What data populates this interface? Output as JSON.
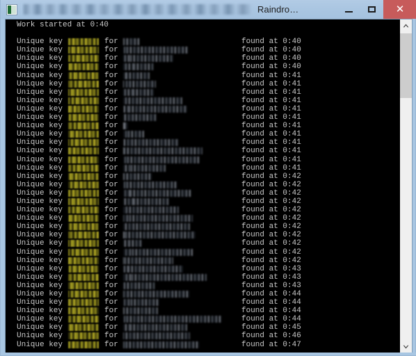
{
  "window": {
    "title_visible": "Raindro…",
    "title_redacted": true,
    "app_icon": "console-icon",
    "caption": {
      "minimize_label": "—",
      "maximize_label": "▢",
      "close_label": "✕",
      "close_color": "#c75b5b"
    },
    "titlebar_color": "#a9c5e1",
    "frame_color": "#a8c6e2"
  },
  "console": {
    "background": "#000000",
    "foreground": "#c9c9c9",
    "key_highlight_color": "#8f8a1c",
    "header": "Work started at 0:40",
    "blank_line": "",
    "labels": {
      "prefix": "Unique key",
      "for": "for",
      "found": "found at"
    },
    "rows": [
      {
        "prefix": "Unique key",
        "key": "REDACTED",
        "for": "for",
        "name": "REDACTED",
        "found": "found at",
        "time": "0:40",
        "key_w": 44,
        "name_w": 24
      },
      {
        "prefix": "Unique key",
        "key": "REDACTED",
        "for": "for",
        "name": "REDACTED",
        "found": "found at",
        "time": "0:40",
        "key_w": 44,
        "name_w": 94
      },
      {
        "prefix": "Unique key",
        "key": "REDACTED",
        "for": "for",
        "name": "REDACTED",
        "found": "found at",
        "time": "0:40",
        "key_w": 44,
        "name_w": 72
      },
      {
        "prefix": "Unique key",
        "key": "REDACTED",
        "for": "for",
        "name": "REDACTED",
        "found": "found at",
        "time": "0:40",
        "key_w": 44,
        "name_w": 44
      },
      {
        "prefix": "Unique key",
        "key": "REDACTED",
        "for": "for",
        "name": "REDACTED",
        "found": "found at",
        "time": "0:41",
        "key_w": 44,
        "name_w": 38
      },
      {
        "prefix": "Unique key",
        "key": "REDACTED",
        "for": "for",
        "name": "REDACTED",
        "found": "found at",
        "time": "0:41",
        "key_w": 44,
        "name_w": 47
      },
      {
        "prefix": "Unique key",
        "key": "REDACTED",
        "for": "for",
        "name": "REDACTED",
        "found": "found at",
        "time": "0:41",
        "key_w": 44,
        "name_w": 44
      },
      {
        "prefix": "Unique key",
        "key": "REDACTED",
        "for": "for",
        "name": "REDACTED",
        "found": "found at",
        "time": "0:41",
        "key_w": 44,
        "name_w": 85
      },
      {
        "prefix": "Unique key",
        "key": "REDACTED",
        "for": "for",
        "name": "REDACTED",
        "found": "found at",
        "time": "0:41",
        "key_w": 44,
        "name_w": 92
      },
      {
        "prefix": "Unique key",
        "key": "REDACTED",
        "for": "for",
        "name": "REDACTED",
        "found": "found at",
        "time": "0:41",
        "key_w": 44,
        "name_w": 48
      },
      {
        "prefix": "Unique key",
        "key": "REDACTED",
        "for": "for",
        "name": "REDACTED",
        "found": "found at",
        "time": "0:41",
        "key_w": 44,
        "name_w": 7
      },
      {
        "prefix": "Unique key",
        "key": "REDACTED",
        "for": "for",
        "name": "REDACTED",
        "found": "found at",
        "time": "0:41",
        "key_w": 44,
        "name_w": 30
      },
      {
        "prefix": "Unique key",
        "key": "REDACTED",
        "for": "for",
        "name": "REDACTED",
        "found": "found at",
        "time": "0:41",
        "key_w": 44,
        "name_w": 80
      },
      {
        "prefix": "Unique key",
        "key": "REDACTED",
        "for": "for",
        "name": "REDACTED",
        "found": "found at",
        "time": "0:41",
        "key_w": 44,
        "name_w": 114
      },
      {
        "prefix": "Unique key",
        "key": "REDACTED",
        "for": "for",
        "name": "REDACTED",
        "found": "found at",
        "time": "0:41",
        "key_w": 44,
        "name_w": 110
      },
      {
        "prefix": "Unique key",
        "key": "REDACTED",
        "for": "for",
        "name": "REDACTED",
        "found": "found at",
        "time": "0:41",
        "key_w": 44,
        "name_w": 61
      },
      {
        "prefix": "Unique key",
        "key": "REDACTED",
        "for": "for",
        "name": "REDACTED",
        "found": "found at",
        "time": "0:42",
        "key_w": 44,
        "name_w": 42
      },
      {
        "prefix": "Unique key",
        "key": "REDACTED",
        "for": "for",
        "name": "REDACTED",
        "found": "found at",
        "time": "0:42",
        "key_w": 44,
        "name_w": 78
      },
      {
        "prefix": "Unique key",
        "key": "REDACTED",
        "for": "for",
        "name": "REDACTED",
        "found": "found at",
        "time": "0:42",
        "key_w": 44,
        "name_w": 98
      },
      {
        "prefix": "Unique key",
        "key": "REDACTED",
        "for": "for",
        "name": "REDACTED",
        "found": "found at",
        "time": "0:42",
        "key_w": 44,
        "name_w": 66
      },
      {
        "prefix": "Unique key",
        "key": "REDACTED",
        "for": "for",
        "name": "REDACTED",
        "found": "found at",
        "time": "0:42",
        "key_w": 44,
        "name_w": 80
      },
      {
        "prefix": "Unique key",
        "key": "REDACTED",
        "for": "for",
        "name": "REDACTED",
        "found": "found at",
        "time": "0:42",
        "key_w": 44,
        "name_w": 100
      },
      {
        "prefix": "Unique key",
        "key": "REDACTED",
        "for": "for",
        "name": "REDACTED",
        "found": "found at",
        "time": "0:42",
        "key_w": 44,
        "name_w": 96
      },
      {
        "prefix": "Unique key",
        "key": "REDACTED",
        "for": "for",
        "name": "REDACTED",
        "found": "found at",
        "time": "0:42",
        "key_w": 44,
        "name_w": 104
      },
      {
        "prefix": "Unique key",
        "key": "REDACTED",
        "for": "for",
        "name": "REDACTED",
        "found": "found at",
        "time": "0:42",
        "key_w": 44,
        "name_w": 27
      },
      {
        "prefix": "Unique key",
        "key": "REDACTED",
        "for": "for",
        "name": "REDACTED",
        "found": "found at",
        "time": "0:42",
        "key_w": 44,
        "name_w": 100
      },
      {
        "prefix": "Unique key",
        "key": "REDACTED",
        "for": "for",
        "name": "REDACTED",
        "found": "found at",
        "time": "0:42",
        "key_w": 44,
        "name_w": 72
      },
      {
        "prefix": "Unique key",
        "key": "REDACTED",
        "for": "for",
        "name": "REDACTED",
        "found": "found at",
        "time": "0:43",
        "key_w": 44,
        "name_w": 86
      },
      {
        "prefix": "Unique key",
        "key": "REDACTED",
        "for": "for",
        "name": "REDACTED",
        "found": "found at",
        "time": "0:43",
        "key_w": 44,
        "name_w": 120
      },
      {
        "prefix": "Unique key",
        "key": "REDACTED",
        "for": "for",
        "name": "REDACTED",
        "found": "found at",
        "time": "0:43",
        "key_w": 44,
        "name_w": 46
      },
      {
        "prefix": "Unique key",
        "key": "REDACTED",
        "for": "for",
        "name": "REDACTED",
        "found": "found at",
        "time": "0:44",
        "key_w": 44,
        "name_w": 96
      },
      {
        "prefix": "Unique key",
        "key": "REDACTED",
        "for": "for",
        "name": "REDACTED",
        "found": "found at",
        "time": "0:44",
        "key_w": 44,
        "name_w": 52
      },
      {
        "prefix": "Unique key",
        "key": "REDACTED",
        "for": "for",
        "name": "REDACTED",
        "found": "found at",
        "time": "0:44",
        "key_w": 44,
        "name_w": 50
      },
      {
        "prefix": "Unique key",
        "key": "REDACTED",
        "for": "for",
        "name": "REDACTED",
        "found": "found at",
        "time": "0:44",
        "key_w": 44,
        "name_w": 142
      },
      {
        "prefix": "Unique key",
        "key": "REDACTED",
        "for": "for",
        "name": "REDACTED",
        "found": "found at",
        "time": "0:45",
        "key_w": 44,
        "name_w": 92
      },
      {
        "prefix": "Unique key",
        "key": "REDACTED",
        "for": "for",
        "name": "REDACTED",
        "found": "found at",
        "time": "0:46",
        "key_w": 44,
        "name_w": 96
      },
      {
        "prefix": "Unique key",
        "key": "REDACTED",
        "for": "for",
        "name": "REDACTED",
        "found": "found at",
        "time": "0:47",
        "key_w": 44,
        "name_w": 110
      }
    ]
  },
  "scrollbar": {
    "up_arrow": "chevron-up-icon",
    "down_arrow": "chevron-down-icon",
    "thumb_color": "#cdcdcd",
    "track_color": "#f0f0f0"
  }
}
